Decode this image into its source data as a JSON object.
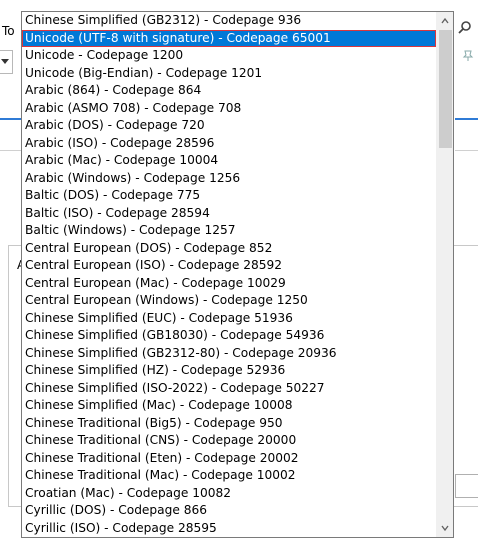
{
  "background": {
    "toolbar_text": "To"
  },
  "dropdown": {
    "items": [
      "Chinese Simplified (GB2312) - Codepage 936",
      "Unicode (UTF-8 with signature) - Codepage 65001",
      "Unicode - Codepage 1200",
      "Unicode (Big-Endian) - Codepage 1201",
      "Arabic (864) - Codepage 864",
      "Arabic (ASMO 708) - Codepage 708",
      "Arabic (DOS) - Codepage 720",
      "Arabic (ISO) - Codepage 28596",
      "Arabic (Mac) - Codepage 10004",
      "Arabic (Windows) - Codepage 1256",
      "Baltic (DOS) - Codepage 775",
      "Baltic (ISO) - Codepage 28594",
      "Baltic (Windows) - Codepage 1257",
      "Central European (DOS) - Codepage 852",
      "Central European (ISO) - Codepage 28592",
      "Central European (Mac) - Codepage 10029",
      "Central European (Windows) - Codepage 1250",
      "Chinese Simplified (EUC) - Codepage 51936",
      "Chinese Simplified (GB18030) - Codepage 54936",
      "Chinese Simplified (GB2312-80) - Codepage 20936",
      "Chinese Simplified (HZ) - Codepage 52936",
      "Chinese Simplified (ISO-2022) - Codepage 50227",
      "Chinese Simplified (Mac) - Codepage 10008",
      "Chinese Traditional (Big5) - Codepage 950",
      "Chinese Traditional (CNS) - Codepage 20000",
      "Chinese Traditional (Eten) - Codepage 20002",
      "Chinese Traditional (Mac) - Codepage 10002",
      "Croatian (Mac) - Codepage 10082",
      "Cyrillic (DOS) - Codepage 866",
      "Cyrillic (ISO) - Codepage 28595"
    ],
    "selected_index": 1,
    "colors": {
      "selection": "#0078d7",
      "focus_outline": "#d9363e"
    }
  },
  "scrollbar": {
    "up_icon": "chevron-up-icon",
    "down_icon": "chevron-down-icon"
  }
}
